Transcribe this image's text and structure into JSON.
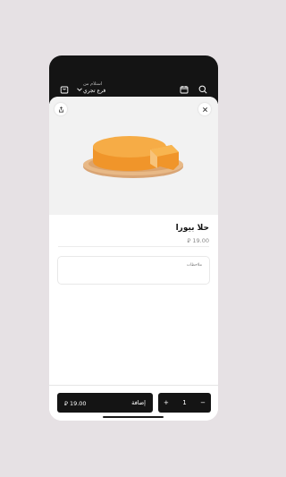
{
  "header": {
    "pickup_label": "استلام من",
    "pickup_value": "فرع تجري"
  },
  "product": {
    "name": "حلا بيورا",
    "price": "19.00",
    "currency_symbol": "⃁"
  },
  "notes": {
    "placeholder": "ملاحظات"
  },
  "cart": {
    "quantity": "1",
    "plus": "+",
    "minus": "−",
    "add_label": "إضافة",
    "total": "19.00"
  },
  "icons": {
    "header_left": [
      "search-icon",
      "calendar-icon"
    ],
    "header_right": [
      "bag-icon",
      "chevron-down-icon"
    ],
    "sheet": [
      "close-icon",
      "share-icon"
    ]
  },
  "colors": {
    "header_bg": "#141414",
    "button_bg": "#141414",
    "cake": "#f29a2e"
  }
}
